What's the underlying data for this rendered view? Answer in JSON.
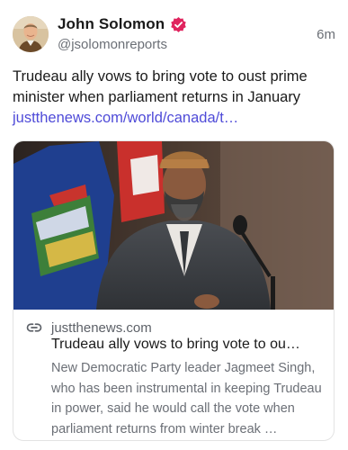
{
  "author": {
    "display_name": "John Solomon",
    "handle": "@jsolomonreports",
    "verified_icon": "verified-badge-icon",
    "verified_color": "#e0245e"
  },
  "post": {
    "timestamp": "6m",
    "text": "Trudeau ally vows to bring vote to oust prime minister when parliament returns in January",
    "link_text": "justthenews.com/world/canada/t…",
    "link_color": "#4f4bd8"
  },
  "embed": {
    "domain": "justthenews.com",
    "title": "Trudeau ally vows to bring vote to ou…",
    "description": "New Democratic Party leader Jagmeet Singh, who has been instrumental in keeping Trudeau in power, said he would call the vote when parliament returns from winter break …",
    "image_alt": "Man in turban and suit speaking at microphone in front of flags",
    "link_icon": "link-icon"
  }
}
